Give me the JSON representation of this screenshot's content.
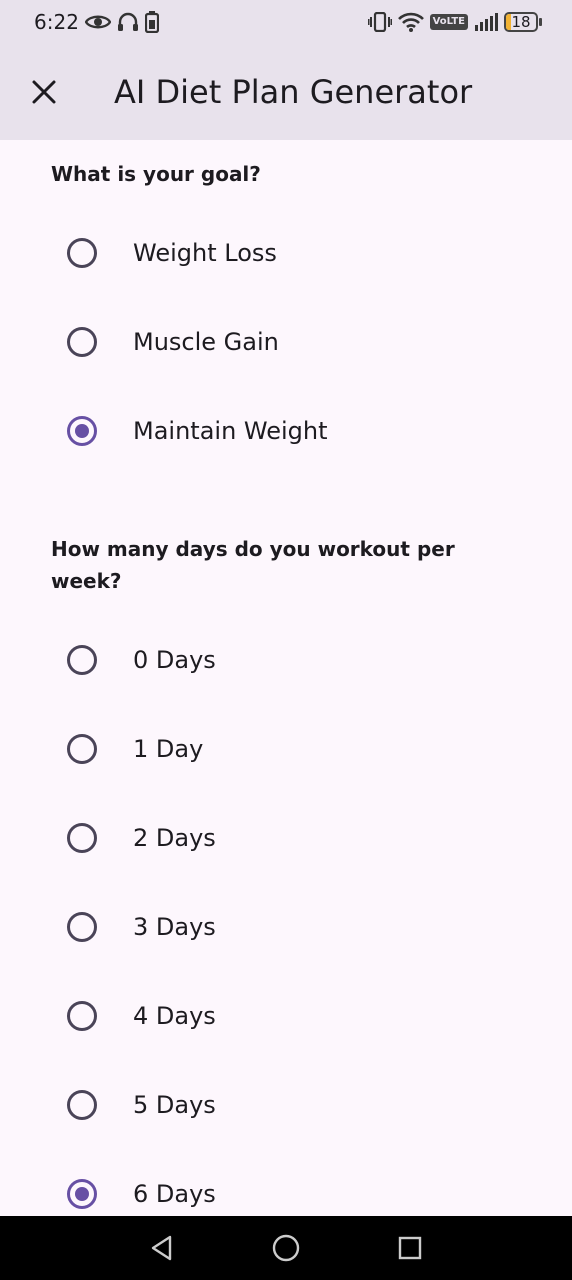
{
  "status_bar": {
    "time": "6:22",
    "battery_level": "18",
    "network_label": "VoLTE",
    "battery_color": "#f2b233"
  },
  "app_bar": {
    "title": "AI Diet Plan Generator",
    "close_icon": "close-icon"
  },
  "goal_section": {
    "question": "What is your goal?",
    "options": [
      {
        "label": "Weight Loss",
        "selected": false
      },
      {
        "label": "Muscle Gain",
        "selected": false
      },
      {
        "label": "Maintain Weight",
        "selected": true
      }
    ]
  },
  "workout_section": {
    "question": "How many days do you workout per week?",
    "options": [
      {
        "label": "0 Days",
        "selected": false
      },
      {
        "label": "1 Day",
        "selected": false
      },
      {
        "label": "2 Days",
        "selected": false
      },
      {
        "label": "3 Days",
        "selected": false
      },
      {
        "label": "4 Days",
        "selected": false
      },
      {
        "label": "5 Days",
        "selected": false
      },
      {
        "label": "6 Days",
        "selected": true
      }
    ]
  },
  "colors": {
    "accent": "#6750a4",
    "app_bar_bg": "#e8e2ec",
    "page_bg": "#fdf7fd"
  }
}
